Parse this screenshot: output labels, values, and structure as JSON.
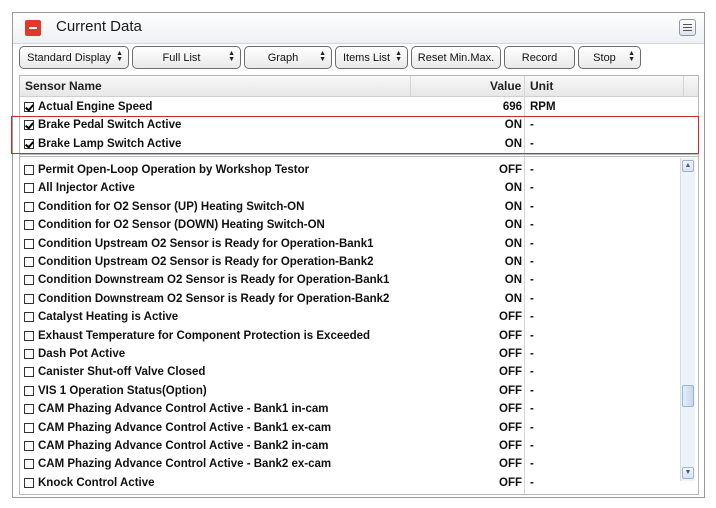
{
  "panel": {
    "title": "Current Data"
  },
  "toolbar": {
    "standard_display": "Standard Display",
    "full_list": "Full List",
    "graph": "Graph",
    "items_list": "Items List",
    "reset": "Reset Min.Max.",
    "record": "Record",
    "stop": "Stop"
  },
  "table": {
    "headers": {
      "name": "Sensor Name",
      "value": "Value",
      "unit": "Unit"
    },
    "pinned": [
      {
        "name": "Actual Engine Speed",
        "value": "696",
        "unit": "RPM",
        "checked": true
      },
      {
        "name": "Brake Pedal Switch Active",
        "value": "ON",
        "unit": "-",
        "checked": true
      },
      {
        "name": "Brake Lamp Switch Active",
        "value": "ON",
        "unit": "-",
        "checked": true
      }
    ],
    "rows": [
      {
        "name": "Permit Open-Loop Operation by Workshop Testor",
        "value": "OFF",
        "unit": "-",
        "checked": false
      },
      {
        "name": "All Injector Active",
        "value": "ON",
        "unit": "-",
        "checked": false
      },
      {
        "name": "Condition for O2 Sensor (UP) Heating Switch-ON",
        "value": "ON",
        "unit": "-",
        "checked": false
      },
      {
        "name": "Condition for O2 Sensor (DOWN) Heating Switch-ON",
        "value": "ON",
        "unit": "-",
        "checked": false
      },
      {
        "name": "Condition Upstream O2 Sensor is Ready for Operation-Bank1",
        "value": "ON",
        "unit": "-",
        "checked": false
      },
      {
        "name": "Condition Upstream O2 Sensor is Ready for Operation-Bank2",
        "value": "ON",
        "unit": "-",
        "checked": false
      },
      {
        "name": "Condition Downstream O2 Sensor is Ready for Operation-Bank1",
        "value": "ON",
        "unit": "-",
        "checked": false
      },
      {
        "name": "Condition Downstream O2 Sensor is Ready for Operation-Bank2",
        "value": "ON",
        "unit": "-",
        "checked": false
      },
      {
        "name": "Catalyst Heating is Active",
        "value": "OFF",
        "unit": "-",
        "checked": false
      },
      {
        "name": "Exhaust Temperature for Component Protection is Exceeded",
        "value": "OFF",
        "unit": "-",
        "checked": false
      },
      {
        "name": "Dash Pot Active",
        "value": "OFF",
        "unit": "-",
        "checked": false
      },
      {
        "name": "Canister Shut-off Valve Closed",
        "value": "OFF",
        "unit": "-",
        "checked": false
      },
      {
        "name": "VIS 1 Operation Status(Option)",
        "value": "OFF",
        "unit": "-",
        "checked": false
      },
      {
        "name": "CAM Phazing Advance Control Active - Bank1 in-cam",
        "value": "OFF",
        "unit": "-",
        "checked": false
      },
      {
        "name": "CAM Phazing Advance Control Active - Bank1 ex-cam",
        "value": "OFF",
        "unit": "-",
        "checked": false
      },
      {
        "name": "CAM Phazing Advance Control Active - Bank2 in-cam",
        "value": "OFF",
        "unit": "-",
        "checked": false
      },
      {
        "name": "CAM Phazing Advance Control Active - Bank2 ex-cam",
        "value": "OFF",
        "unit": "-",
        "checked": false
      },
      {
        "name": "Knock Control Active",
        "value": "OFF",
        "unit": "-",
        "checked": false
      }
    ]
  },
  "colors": {
    "highlight": "#d42a2a",
    "collapse_button": "#e0392b"
  }
}
